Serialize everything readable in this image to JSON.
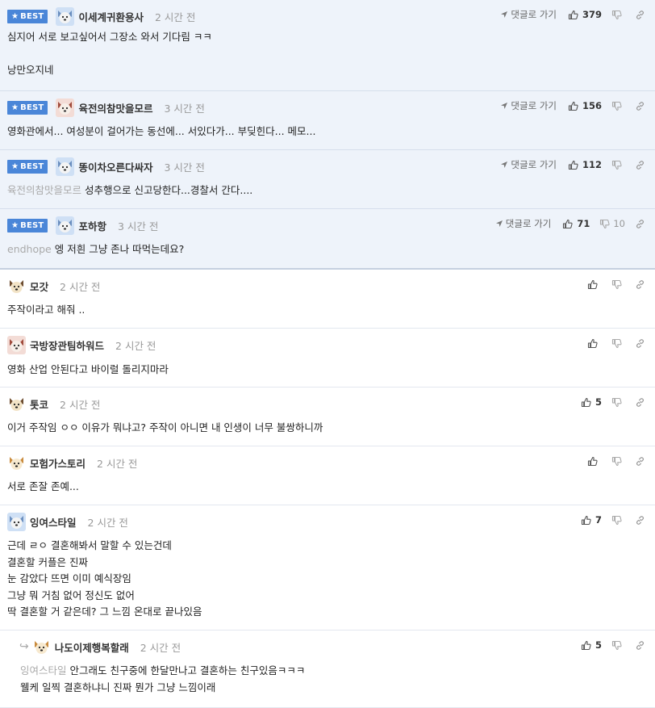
{
  "labels": {
    "best": "BEST",
    "goto_reply": "댓글로 가기"
  },
  "comments": [
    {
      "best": true,
      "avatar": "blue-dog",
      "nick": "이세계귀환용사",
      "time": "2 시간 전",
      "lines": [
        "심지어 서로 보고싶어서 그장소 와서 기다림 ㅋㅋ",
        "",
        "낭만오지네"
      ],
      "likes": "379",
      "dislikes": ""
    },
    {
      "best": true,
      "avatar": "red-dog",
      "nick": "육전의참맛을모르",
      "time": "3 시간 전",
      "lines": [
        "영화관에서... 여성분이 걸어가는 동선에... 서있다가... 부딪힌다... 메모..."
      ],
      "likes": "156",
      "dislikes": ""
    },
    {
      "best": true,
      "avatar": "blue-dog",
      "nick": "똥이차오른다싸자",
      "time": "3 시간 전",
      "mention": "육전의참맛을모르",
      "lines": [
        "성추행으로 신고당한다...경찰서 간다...."
      ],
      "likes": "112",
      "dislikes": ""
    },
    {
      "best": true,
      "avatar": "blue-dog",
      "nick": "포하항",
      "time": "3 시간 전",
      "mention": "endhope",
      "lines": [
        "엥 저흰 그냥 존나 따먹는데요?"
      ],
      "likes": "71",
      "dislikes": "10"
    },
    {
      "best": false,
      "avatar": "brown-dog",
      "nick": "모갓",
      "time": "2 시간 전",
      "lines": [
        "주작이라고 해줘 .."
      ],
      "likes": "",
      "dislikes": ""
    },
    {
      "best": false,
      "avatar": "red-dog",
      "nick": "국방장관팀하워드",
      "time": "2 시간 전",
      "lines": [
        "영화 산업 안된다고 바이럴 돌리지마라"
      ],
      "likes": "",
      "dislikes": ""
    },
    {
      "best": false,
      "avatar": "brown-dog",
      "nick": "톳코",
      "time": "2 시간 전",
      "lines": [
        "이거 주작임 ㅇㅇ 이유가 뭐냐고? 주작이 아니면 내 인생이 너무 불쌍하니까"
      ],
      "likes": "5",
      "dislikes": ""
    },
    {
      "best": false,
      "avatar": "fox-dog",
      "nick": "모험가스토리",
      "time": "2 시간 전",
      "lines": [
        "서로 존잘 존예..."
      ],
      "likes": "",
      "dislikes": ""
    },
    {
      "best": false,
      "avatar": "blue-dog",
      "nick": "잉여스타일",
      "time": "2 시간 전",
      "lines": [
        "근데 ㄹㅇ 결혼해봐서 말할 수 있는건데",
        "결혼할 커플은 진짜",
        "눈 감았다 뜨면 이미 예식장임",
        "그냥 뭐 거침 없어 정신도 없어",
        "딱 결혼할 거 같은데? 그 느낌 온대로 끝나있음"
      ],
      "likes": "7",
      "dislikes": ""
    },
    {
      "best": false,
      "reply": true,
      "avatar": "fox-dog",
      "nick": "나도이제행복할래",
      "time": "2 시간 전",
      "mention": "잉여스타일",
      "lines": [
        "안그래도 친구중에 한달만나고 결혼하는 친구있음ㅋㅋㅋ",
        "웰케 일찍 결혼하냐니 진짜 뭔가 그냥 느낌이래"
      ],
      "likes": "5",
      "dislikes": ""
    }
  ]
}
